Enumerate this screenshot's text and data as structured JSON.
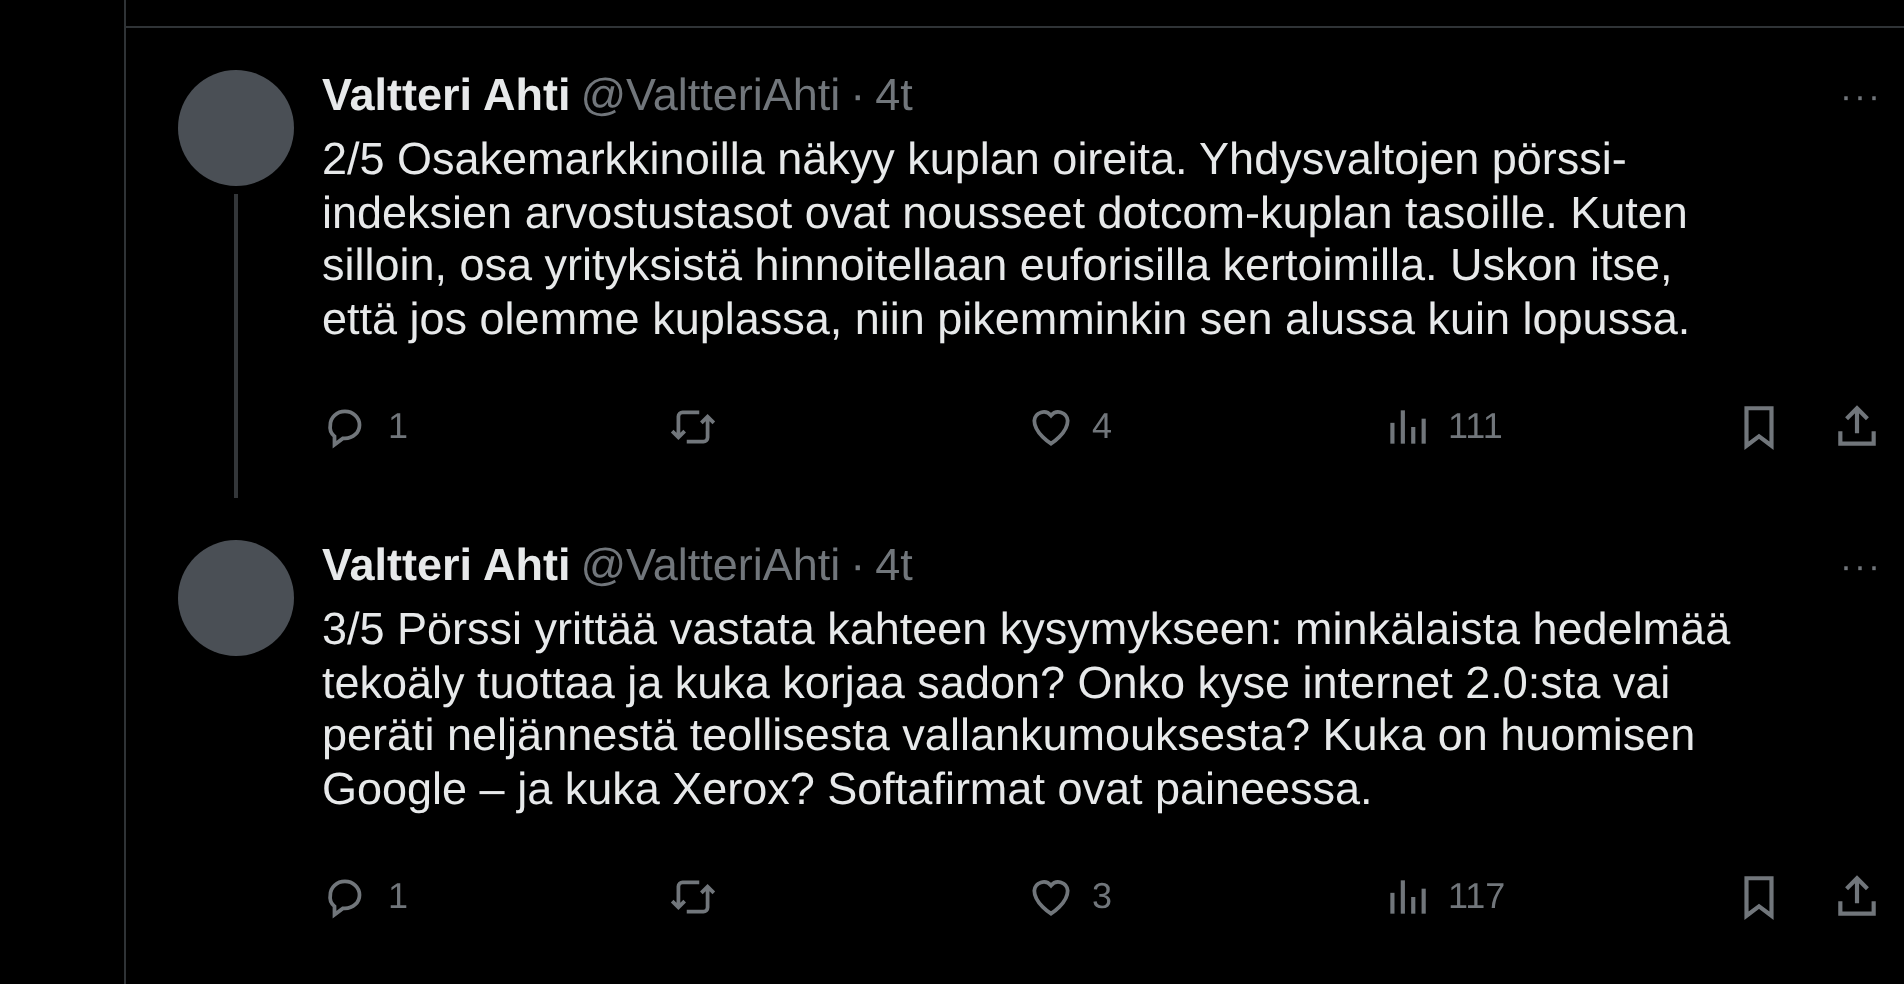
{
  "tweets": [
    {
      "name": "Valtteri Ahti",
      "handle": "@ValtteriAhti",
      "separator": "·",
      "time": "4t",
      "more": "···",
      "text": "2/5 Osakemarkkinoilla näkyy kuplan oireita. Yhdysvaltojen pörssi-indeksien arvostustasot ovat nousseet dotcom-kuplan tasoille. Kuten silloin, osa yrityksistä hinnoitellaan euforisilla kertoimilla. Uskon itse, että jos olemme kuplassa, niin pikemminkin sen alussa kuin lopussa.",
      "thread_continues": true,
      "replies": "1",
      "likes": "4",
      "views": "111"
    },
    {
      "name": "Valtteri Ahti",
      "handle": "@ValtteriAhti",
      "separator": "·",
      "time": "4t",
      "more": "···",
      "text": "3/5 Pörssi yrittää vastata kahteen kysymykseen: minkälaista hedelmää tekoäly tuottaa ja kuka korjaa sadon? Onko kyse internet 2.0:sta vai peräti neljännestä teollisesta vallankumouksesta? Kuka on huomisen Google – ja kuka Xerox? Softafirmat ovat paineessa.",
      "thread_continues": false,
      "replies": "1",
      "likes": "3",
      "views": "117"
    }
  ]
}
